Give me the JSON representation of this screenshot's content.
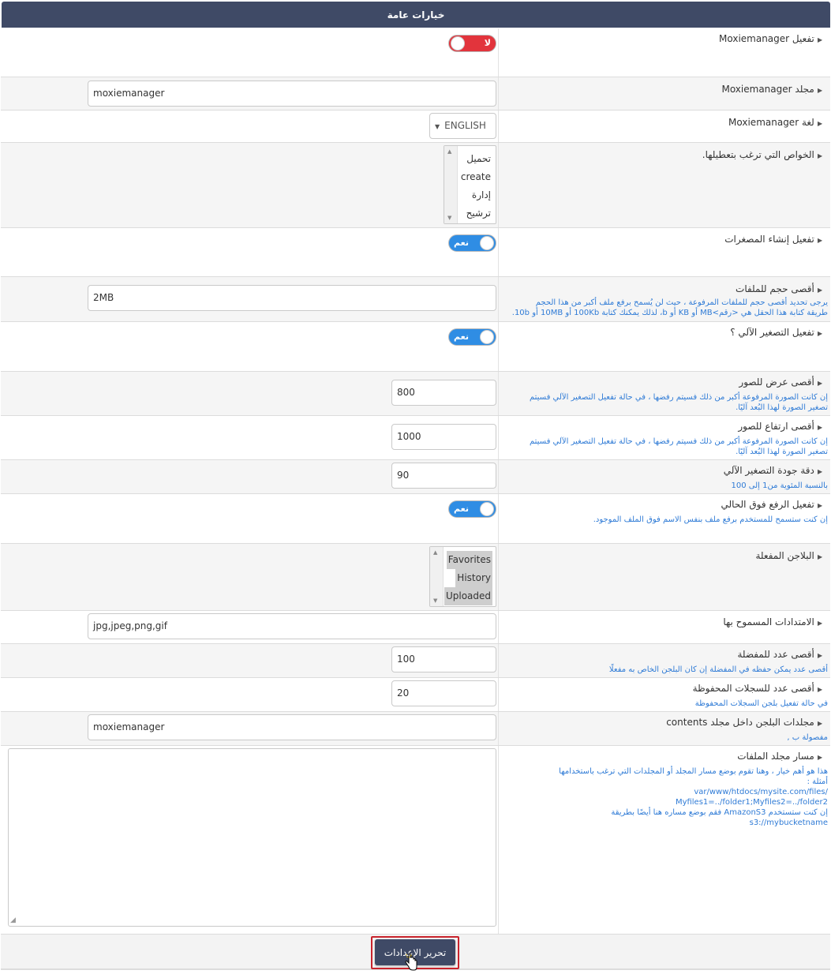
{
  "header": {
    "title": "خيارات عامة"
  },
  "fields": {
    "enable": {
      "label": "تفعيل Moxiemanager",
      "toggle": "لا"
    },
    "folder": {
      "label": "مجلد Moxiemanager",
      "value": "moxiemanager"
    },
    "language": {
      "label": "لغة Moxiemanager",
      "value": "ENGLISH"
    },
    "disabled_features": {
      "label": "الخواص التي ترغب بتعطيلها.",
      "options": [
        "تحميل",
        "create",
        "إدارة",
        "ترشيح"
      ]
    },
    "thumbnails": {
      "label": "تفعيل إنشاء المصغرات",
      "toggle": "نعم"
    },
    "max_file_size": {
      "label": "أقصى حجم للملفات",
      "value": "2MB",
      "hint1": "يرجى تحديد أقصى حجم للملفات المرفوعة ، حيث لن يُسمح برفع ملف أكبر من هذا الحجم",
      "hint2": "طريقة كتابة هذا الحقل هي <رقم>MB أو KB أو b، لذلك يمكنك كتابة 100Kb أو 10MB أو 10b."
    },
    "auto_resize": {
      "label": "تفعيل التصغير الآلي ؟",
      "toggle": "نعم"
    },
    "max_width": {
      "label": "أقصى عرض للصور",
      "value": "800",
      "hint1": "إن كانت الصورة المرفوعة أكبر من ذلك فسيتم رفضها ، في حالة تفعيل التصغير الآلي فسيتم",
      "hint2": "تصغير الصورة لهذا البُعد آليًا."
    },
    "max_height": {
      "label": "أقصى ارتفاع للصور",
      "value": "1000",
      "hint1": "إن كانت الصورة المرفوعة أكبر من ذلك فسيتم رفضها ، في حالة تفعيل التصغير الآلي فسيتم",
      "hint2": "تصغير الصورة لهذا البُعد آليًا."
    },
    "resize_quality": {
      "label": "دقة جودة التصغير الآلي",
      "value": "90",
      "hint1": "بالنسبة المئوية من1 إلى 100"
    },
    "overwrite": {
      "label": "تفعيل الرفع فوق الحالي",
      "toggle": "نعم",
      "hint1": "إن كنت ستسمح للمستخدم برفع ملف بنفس الاسم فوق الملف الموجود."
    },
    "plugins": {
      "label": "البلاجن المفعلة",
      "options": [
        "Favorites",
        "History",
        "Uploaded"
      ]
    },
    "extensions": {
      "label": "الامتدادات المسموح بها",
      "value": "jpg,jpeg,png,gif"
    },
    "max_favorites": {
      "label": "أقصى عدد للمفضلة",
      "value": "100",
      "hint1": "أقصى عدد يمكن حفظه في المفضلة إن كان البلجن الخاص به مفعلًا"
    },
    "max_history": {
      "label": "أقصى عدد للسجلات المحفوظة",
      "value": "20",
      "hint1": "في حالة تفعيل بلجن السجلات المحفوظة"
    },
    "plugin_folders": {
      "label": "مجلدات البلجن داخل مجلد contents",
      "value": "moxiemanager",
      "hint1": "مفصولة ب ,"
    },
    "files_path": {
      "label": "مسار مجلد الملفات",
      "hint_lines": [
        "هذا هو أهم خيار ، وهنا تقوم بوضع مسار المجلد أو المجلدات التي ترغب باستخدامها",
        "أمثلة :",
        "/var/www/htdocs/mysite.com/files",
        "Myfiles1=../folder1;Myfiles2=../folder2",
        "إن كنت ستستخدم AmazonS3 فقم بوضع مساره هنا أيضًا بطريقة",
        "s3://mybucketname"
      ]
    }
  },
  "footer": {
    "submit_label": "تحرير الإعدادات"
  }
}
